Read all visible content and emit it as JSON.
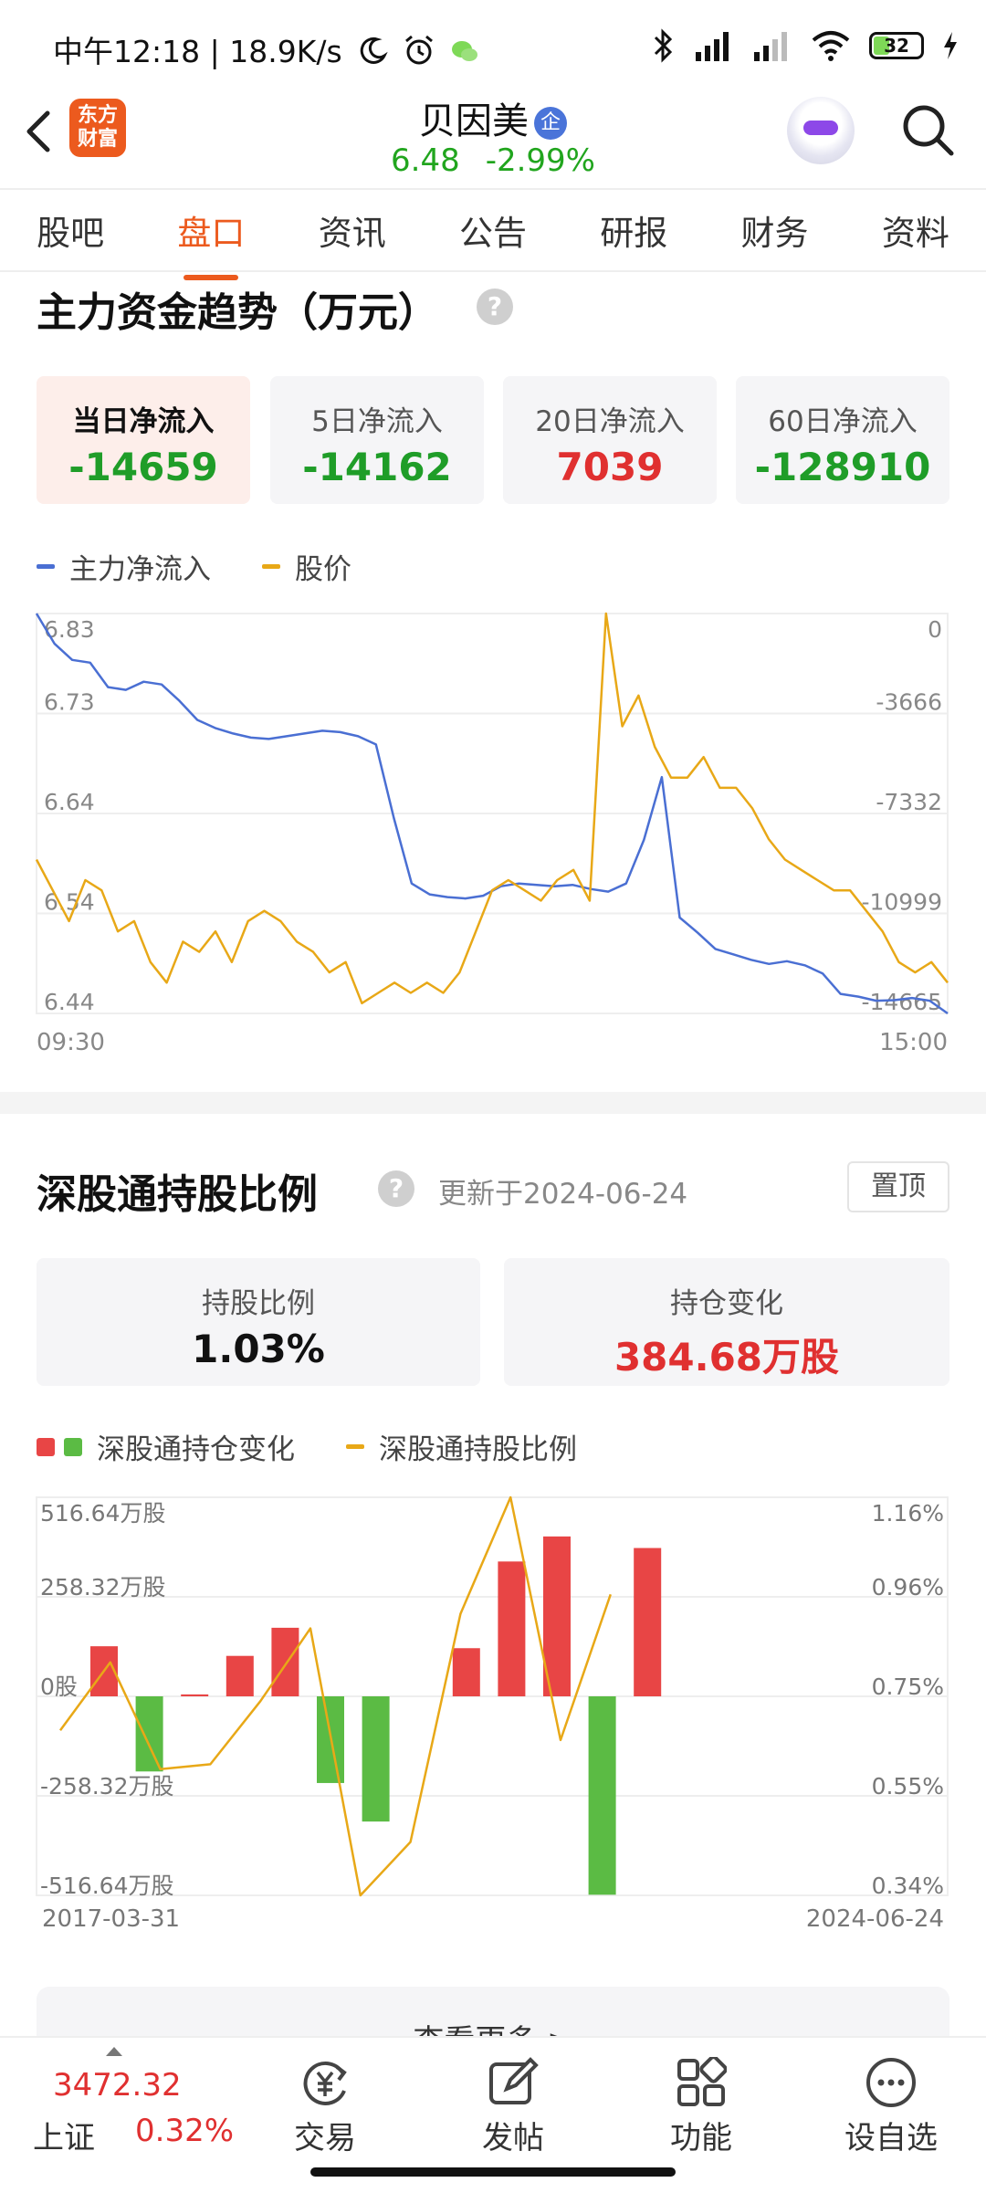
{
  "status_bar": {
    "time": "中午12:18",
    "speed": "18.9K/s",
    "battery": "32",
    "battery_level": 0.32
  },
  "header": {
    "logo_lines": [
      "东方",
      "财富"
    ],
    "stock_name": "贝因美",
    "badge": "企",
    "price": "6.48",
    "change": "-2.99%"
  },
  "tabs": [
    {
      "label": "股吧",
      "active": false
    },
    {
      "label": "盘口",
      "active": true
    },
    {
      "label": "资讯",
      "active": false
    },
    {
      "label": "公告",
      "active": false
    },
    {
      "label": "研报",
      "active": false
    },
    {
      "label": "财务",
      "active": false
    },
    {
      "label": "资料",
      "active": false
    }
  ],
  "fund_flow": {
    "title": "主力资金趋势（万元）",
    "help": "?",
    "cards": [
      {
        "label": "当日净流入",
        "value": "-14659",
        "color": "#1f9d28"
      },
      {
        "label": "5日净流入",
        "value": "-14162",
        "color": "#1f9d28"
      },
      {
        "label": "20日净流入",
        "value": "7039",
        "color": "#e03030"
      },
      {
        "label": "60日净流入",
        "value": "-128910",
        "color": "#1f9d28"
      }
    ],
    "legend": {
      "series1": "主力净流入",
      "series2": "股价"
    }
  },
  "holding": {
    "title": "深股通持股比例",
    "help": "?",
    "updated": "更新于2024-06-24",
    "pin_label": "置顶",
    "cards": [
      {
        "label": "持股比例",
        "value": "1.03%",
        "color": "#111111"
      },
      {
        "label": "持仓变化",
        "value": "384.68万股",
        "color": "#e03030"
      }
    ],
    "legend": {
      "series1": "深股通持仓变化",
      "series2": "深股通持股比例"
    },
    "more_label": "查看更多 >"
  },
  "chart_data": [
    {
      "type": "line",
      "x_labels": [
        "09:30",
        "15:00"
      ],
      "y_left_ticks": [
        "6.83",
        "6.73",
        "6.64",
        "6.54",
        "6.44"
      ],
      "y_right_ticks": [
        "0",
        "-3666",
        "-7332",
        "-10999",
        "-14665"
      ],
      "y_left_range": [
        6.44,
        6.83
      ],
      "y_right_range": [
        -14665,
        0
      ],
      "series": [
        {
          "name": "主力净流入",
          "color": "#4a6fd3",
          "axis": "right",
          "values": [
            0,
            -1100,
            -1700,
            -1800,
            -2700,
            -2800,
            -2500,
            -2600,
            -3200,
            -3900,
            -4200,
            -4400,
            -4550,
            -4600,
            -4500,
            -4400,
            -4300,
            -4350,
            -4500,
            -4800,
            -7500,
            -9900,
            -10300,
            -10400,
            -10450,
            -10350,
            -10000,
            -9900,
            -9950,
            -10000,
            -9950,
            -10100,
            -10200,
            -9900,
            -8300,
            -6000,
            -11150,
            -11700,
            -12300,
            -12500,
            -12700,
            -12850,
            -12750,
            -12900,
            -13200,
            -13950,
            -14050,
            -14200,
            -14180,
            -14100,
            -14200,
            -14665
          ]
        },
        {
          "name": "股价",
          "color": "#e8a817",
          "axis": "left",
          "values": [
            6.59,
            6.56,
            6.53,
            6.57,
            6.56,
            6.52,
            6.53,
            6.49,
            6.47,
            6.51,
            6.5,
            6.52,
            6.49,
            6.53,
            6.54,
            6.53,
            6.51,
            6.5,
            6.48,
            6.49,
            6.45,
            6.46,
            6.47,
            6.46,
            6.47,
            6.46,
            6.48,
            6.52,
            6.56,
            6.57,
            6.56,
            6.55,
            6.57,
            6.58,
            6.55,
            6.83,
            6.72,
            6.75,
            6.7,
            6.67,
            6.67,
            6.69,
            6.66,
            6.66,
            6.64,
            6.61,
            6.59,
            6.58,
            6.57,
            6.56,
            6.56,
            6.54,
            6.52,
            6.49,
            6.48,
            6.49,
            6.47
          ]
        }
      ]
    },
    {
      "type": "bar",
      "x_labels": [
        "2017-03-31",
        "2024-06-24"
      ],
      "y_left_ticks": [
        "516.64万股",
        "258.32万股",
        "0股",
        "-258.32万股",
        "-516.64万股"
      ],
      "y_right_ticks": [
        "1.16%",
        "0.96%",
        "0.75%",
        "0.55%",
        "0.34%"
      ],
      "y_left_range": [
        -516.64,
        516.64
      ],
      "y_right_range": [
        0.34,
        1.16
      ],
      "series": [
        {
          "name": "深股通持仓变化",
          "colors": {
            "positive": "#e84545",
            "negative": "#5bbb44"
          },
          "values": [
            130,
            -195,
            5,
            105,
            178,
            -225,
            -325,
            0,
            125,
            350,
            415,
            -515,
            385
          ]
        },
        {
          "name": "深股通持股比例",
          "color": "#e8a817",
          "values": [
            0.68,
            0.82,
            0.6,
            0.61,
            0.74,
            0.89,
            0.34,
            0.45,
            0.92,
            1.16,
            0.66,
            0.96
          ]
        }
      ]
    }
  ]
}
